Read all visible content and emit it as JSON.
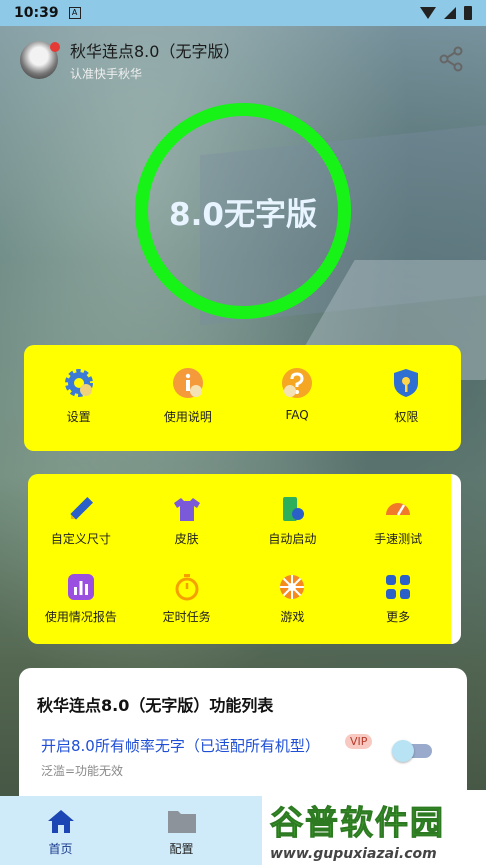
{
  "status": {
    "time": "10:39",
    "notif_glyph": "A"
  },
  "header": {
    "title": "秋华连点8.0（无字版）",
    "subtitle": "认准快手秋华"
  },
  "ring": {
    "text": "8.0无字版",
    "color": "#17f217"
  },
  "top_menu": [
    {
      "label": "设置",
      "icon": "gear-icon"
    },
    {
      "label": "使用说明",
      "icon": "info-icon"
    },
    {
      "label": "FAQ",
      "icon": "question-icon"
    },
    {
      "label": "权限",
      "icon": "shield-key-icon"
    }
  ],
  "tools": [
    {
      "label": "自定义尺寸",
      "icon": "ruler-pencil-icon"
    },
    {
      "label": "皮肤",
      "icon": "shirt-icon"
    },
    {
      "label": "自动启动",
      "icon": "phone-sync-icon"
    },
    {
      "label": "手速测试",
      "icon": "speedometer-icon"
    },
    {
      "label": "使用情况报告",
      "icon": "bar-chart-icon"
    },
    {
      "label": "定时任务",
      "icon": "stopwatch-icon"
    },
    {
      "label": "游戏",
      "icon": "wheel-icon"
    },
    {
      "label": "更多",
      "icon": "grid-icon"
    }
  ],
  "panel": {
    "title": "秋华连点8.0（无字版）功能列表",
    "feature_label": "开启8.0所有帧率无字（已适配所有机型）",
    "vip_badge": "VIP",
    "feature_sub": "泛滥=功能无效",
    "toggle_on": false
  },
  "nav": [
    {
      "label": "首页",
      "icon": "home-icon",
      "active": true
    },
    {
      "label": "配置",
      "icon": "folder-icon",
      "active": false
    }
  ],
  "watermark": {
    "brand": "谷普软件园",
    "url": "www.gupuxiazai.com"
  },
  "colors": {
    "accent_yellow": "#ffff00",
    "statusbar": "#8ec9e8",
    "nav_bg": "#cfeaf8",
    "link_blue": "#1f4fd6"
  }
}
